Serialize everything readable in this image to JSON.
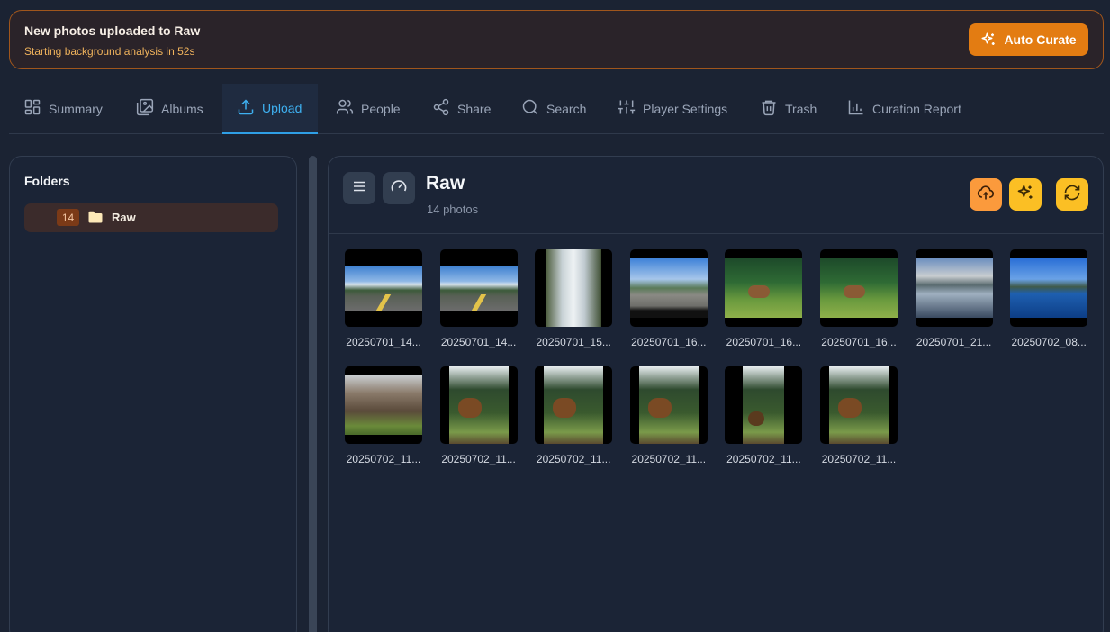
{
  "banner": {
    "title": "New photos uploaded to Raw",
    "subtitle": "Starting background analysis in 52s",
    "button_label": "Auto Curate",
    "accent": "#e37c12"
  },
  "tabs": [
    {
      "label": "Summary",
      "icon": "grid-icon"
    },
    {
      "label": "Albums",
      "icon": "images-icon"
    },
    {
      "label": "Upload",
      "icon": "upload-icon",
      "active": true
    },
    {
      "label": "People",
      "icon": "people-icon"
    },
    {
      "label": "Share",
      "icon": "share-icon"
    },
    {
      "label": "Search",
      "icon": "search-icon"
    },
    {
      "label": "Player Settings",
      "icon": "sliders-icon"
    },
    {
      "label": "Trash",
      "icon": "trash-icon"
    },
    {
      "label": "Curation Report",
      "icon": "bar-chart-icon"
    }
  ],
  "sidebar": {
    "title": "Folders",
    "folders": [
      {
        "count": "14",
        "name": "Raw"
      }
    ]
  },
  "main": {
    "folder_title": "Raw",
    "photo_count": "14 photos",
    "photos": [
      {
        "caption": "20250701_14...",
        "scene": "road"
      },
      {
        "caption": "20250701_14...",
        "scene": "road"
      },
      {
        "caption": "20250701_15...",
        "scene": "waterfall"
      },
      {
        "caption": "20250701_16...",
        "scene": "road-dash"
      },
      {
        "caption": "20250701_16...",
        "scene": "elk"
      },
      {
        "caption": "20250701_16...",
        "scene": "elk"
      },
      {
        "caption": "20250701_21...",
        "scene": "lake"
      },
      {
        "caption": "20250702_08...",
        "scene": "lake-blue"
      },
      {
        "caption": "20250702_11...",
        "scene": "forest"
      },
      {
        "caption": "20250702_11...",
        "scene": "bear"
      },
      {
        "caption": "20250702_11...",
        "scene": "bear"
      },
      {
        "caption": "20250702_11...",
        "scene": "bear"
      },
      {
        "caption": "20250702_11...",
        "scene": "bear-narrow"
      },
      {
        "caption": "20250702_11...",
        "scene": "bear"
      }
    ]
  }
}
